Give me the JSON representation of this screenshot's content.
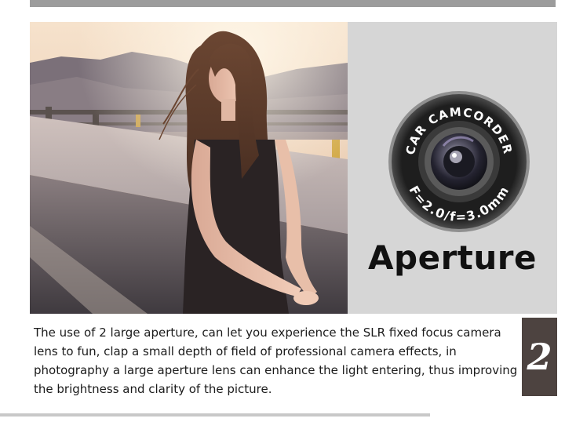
{
  "aperture_panel": {
    "title": "Aperture",
    "lens_ring_top_text": "CAR CAMCORDER",
    "lens_ring_bottom_text": "F=2.0/f=3.0mm"
  },
  "description": {
    "text": "The use of 2 large aperture, can let you experience the SLR fixed focus camera lens to fun, clap a small depth of field of professional camera effects, in photography a large aperture lens can enhance the light entering, thus improving the brightness and clarity of the picture."
  },
  "badge": {
    "number": "2"
  },
  "colors": {
    "top_bar": "#9c9c9c",
    "panel_background": "#d6d6d6",
    "badge_background": "#4d4340",
    "title_text": "#111111"
  }
}
